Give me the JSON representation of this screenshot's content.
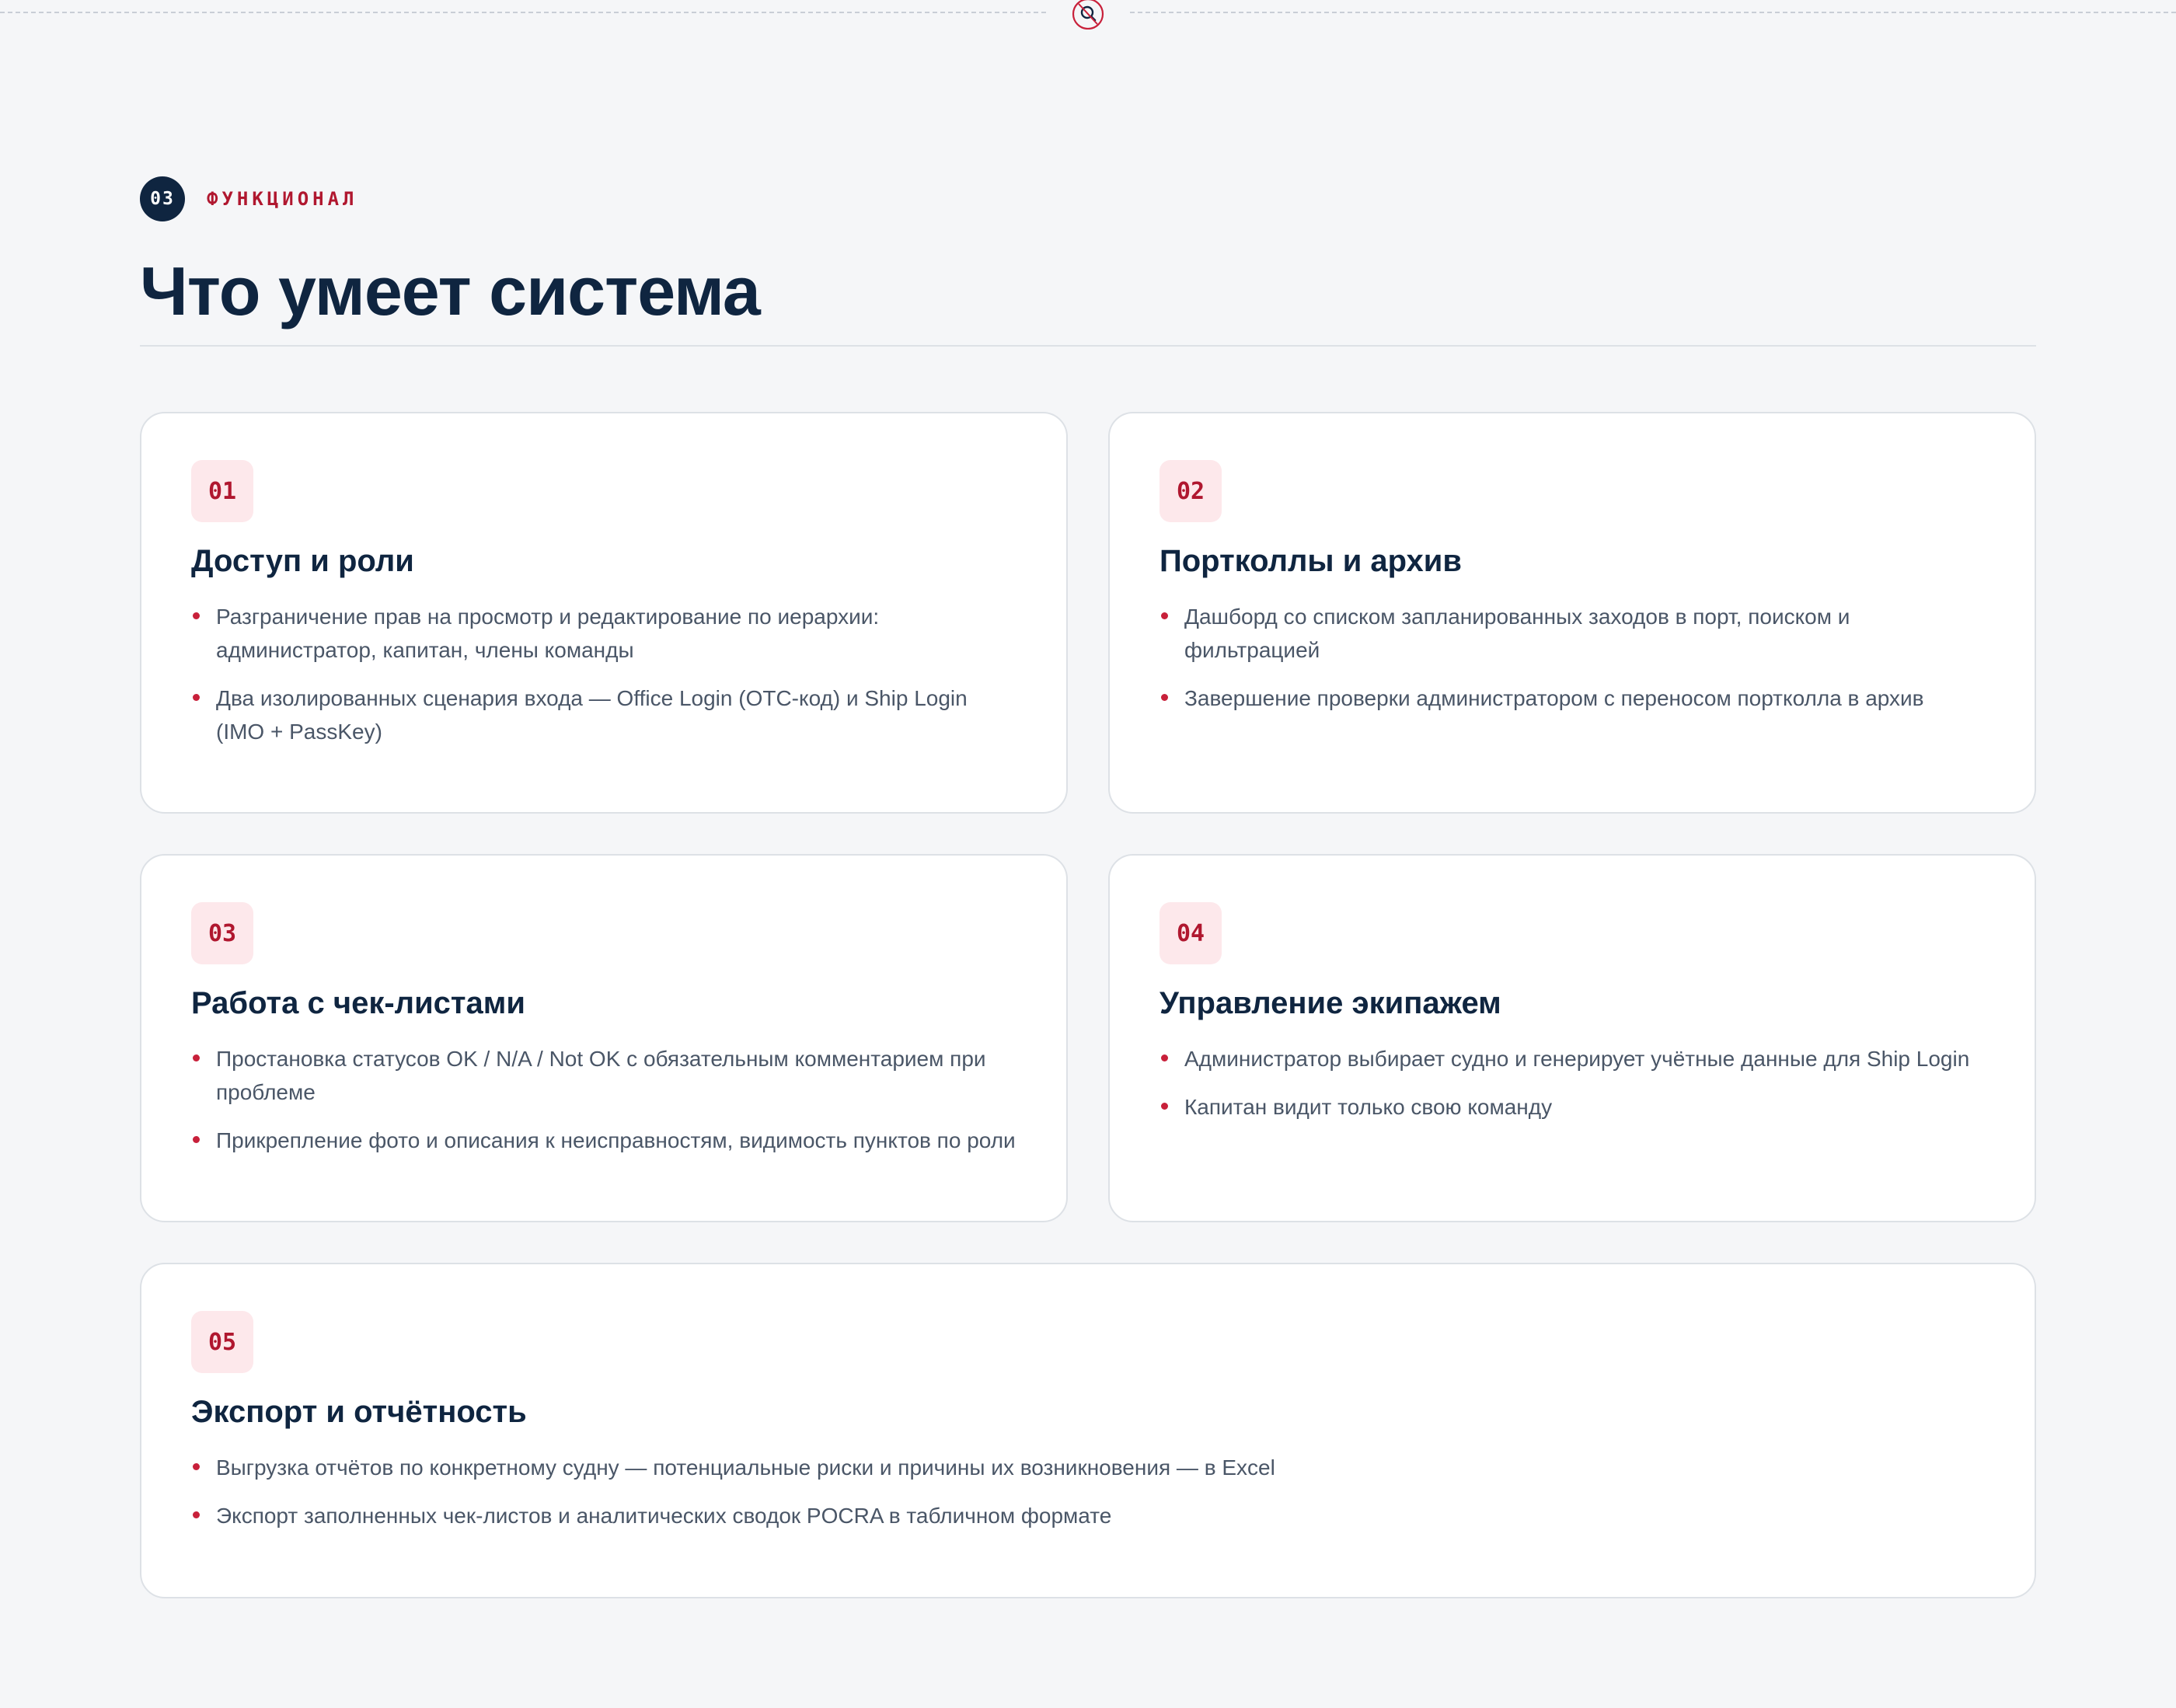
{
  "section": {
    "number": "03",
    "label": "ФУНКЦИОНАЛ",
    "title": "Что умеет система"
  },
  "accent_color": "#b0172f",
  "primary_color": "#0f2540",
  "divider_icon": "magnifier-crossed-icon",
  "cards": [
    {
      "number": "01",
      "title": "Доступ и роли",
      "items": [
        "Разграничение прав на просмотр и редактирование по иерархии: администратор, капитан, члены команды",
        "Два изолированных сценария входа — Office Login (OTC-код) и Ship Login (IMO + PassKey)"
      ]
    },
    {
      "number": "02",
      "title": "Портколлы и архив",
      "items": [
        "Дашборд со списком запланированных заходов в порт, поиском и фильтрацией",
        "Завершение проверки администратором с переносом портколла в архив"
      ]
    },
    {
      "number": "03",
      "title": "Работа с чек-листами",
      "items": [
        "Простановка статусов OK / N/A / Not OK с обязательным комментарием при проблеме",
        "Прикрепление фото и описания к неисправностям, видимость пунктов по роли"
      ]
    },
    {
      "number": "04",
      "title": "Управление экипажем",
      "items": [
        "Администратор выбирает судно и генерирует учётные данные для Ship Login",
        "Капитан видит только свою команду"
      ]
    },
    {
      "number": "05",
      "title": "Экспорт и отчётность",
      "items": [
        "Выгрузка отчётов по конкретному судну — потенциальные риски и причины их возникновения — в Excel",
        "Экспорт заполненных чек-листов и аналитических сводок POCRA в табличном формате"
      ]
    }
  ]
}
